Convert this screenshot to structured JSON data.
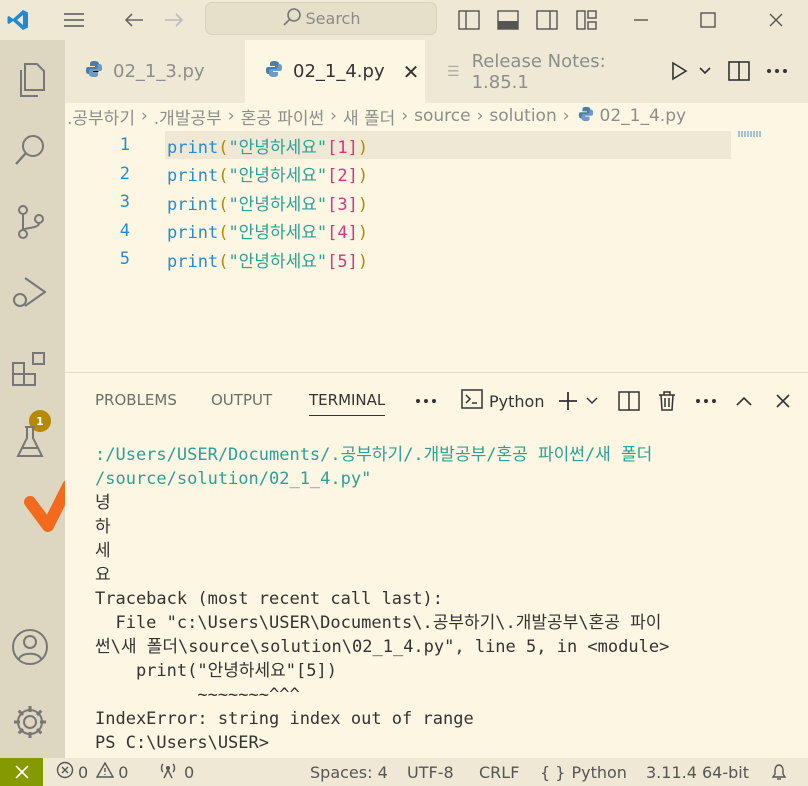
{
  "titlebar": {
    "search_placeholder": "Search"
  },
  "activity": {
    "extensions_badge": "1"
  },
  "tabs": [
    {
      "label": "02_1_3.py",
      "active": false
    },
    {
      "label": "02_1_4.py",
      "active": true
    },
    {
      "label": "Release Notes: 1.85.1",
      "active": false
    }
  ],
  "breadcrumb": [
    ".공부하기",
    ".개발공부",
    "혼공 파이썬",
    "새 폴더",
    "source",
    "solution",
    "02_1_4.py"
  ],
  "editor": {
    "lines": [
      {
        "num": "1",
        "fn": "print",
        "str": "\"안녕하세요\"",
        "idx": "1"
      },
      {
        "num": "2",
        "fn": "print",
        "str": "\"안녕하세요\"",
        "idx": "2"
      },
      {
        "num": "3",
        "fn": "print",
        "str": "\"안녕하세요\"",
        "idx": "3"
      },
      {
        "num": "4",
        "fn": "print",
        "str": "\"안녕하세요\"",
        "idx": "4"
      },
      {
        "num": "5",
        "fn": "print",
        "str": "\"안녕하세요\"",
        "idx": "5"
      }
    ]
  },
  "panel": {
    "tabs": [
      "PROBLEMS",
      "OUTPUT",
      "TERMINAL"
    ],
    "active_tab": "TERMINAL",
    "terminal_profile": "Python",
    "terminal_lines": [
      {
        "text": ":/Users/USER/Documents/.공부하기/.개발공부/혼공 파이썬/새 폴더",
        "kind": "path"
      },
      {
        "text": "/source/solution/02_1_4.py\"",
        "kind": "path"
      },
      {
        "text": "녕",
        "kind": "out"
      },
      {
        "text": "하",
        "kind": "out"
      },
      {
        "text": "세",
        "kind": "out"
      },
      {
        "text": "요",
        "kind": "out"
      },
      {
        "text": "Traceback (most recent call last):",
        "kind": "out"
      },
      {
        "text": "  File \"c:\\Users\\USER\\Documents\\.공부하기\\.개발공부\\혼공 파이",
        "kind": "out"
      },
      {
        "text": "썬\\새 폴더\\source\\solution\\02_1_4.py\", line 5, in <module>",
        "kind": "out"
      },
      {
        "text": "    print(\"안녕하세요\"[5])",
        "kind": "out"
      },
      {
        "text": "          ~~~~~~~^^^",
        "kind": "out"
      },
      {
        "text": "IndexError: string index out of range",
        "kind": "out"
      },
      {
        "text": "PS C:\\Users\\USER>",
        "kind": "out"
      }
    ]
  },
  "statusbar": {
    "errors": "0",
    "warnings": "0",
    "ports": "0",
    "spaces": "Spaces: 4",
    "encoding": "UTF-8",
    "eol": "CRLF",
    "language": "Python",
    "interpreter": "3.11.4 64-bit"
  },
  "colors": {
    "accent_badge": "#b58900",
    "remote": "#859900",
    "terminal_path": "#2aa198",
    "line_number": "#268bd2"
  }
}
